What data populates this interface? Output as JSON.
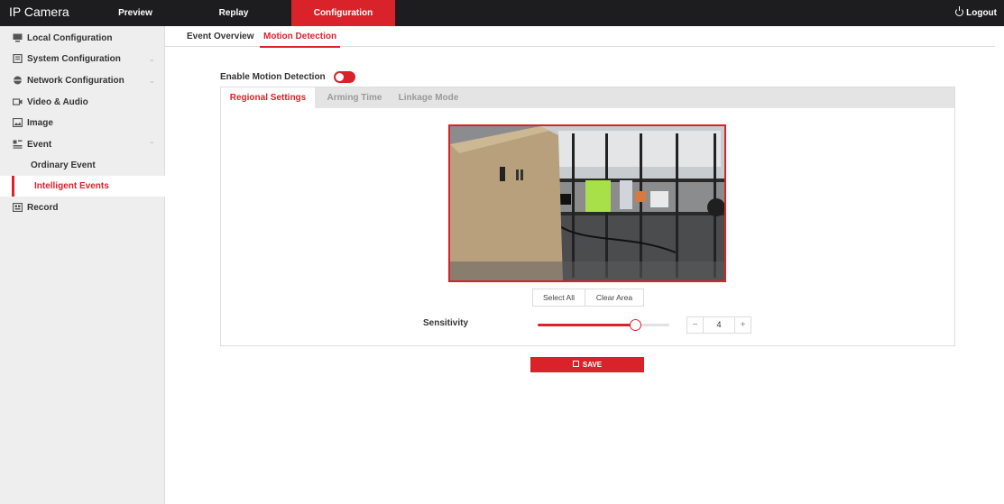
{
  "app": {
    "title": "IP Camera"
  },
  "topnav": {
    "items": [
      {
        "label": "Preview"
      },
      {
        "label": "Replay"
      },
      {
        "label": "Configuration"
      }
    ],
    "logout_label": "Logout"
  },
  "sidebar": {
    "items": [
      {
        "label": "Local Configuration",
        "icon": "monitor-icon"
      },
      {
        "label": "System Configuration",
        "icon": "system-icon",
        "chevron": "⌄"
      },
      {
        "label": "Network Configuration",
        "icon": "globe-icon",
        "chevron": "⌄"
      },
      {
        "label": "Video & Audio",
        "icon": "video-audio-icon"
      },
      {
        "label": "Image",
        "icon": "image-icon"
      },
      {
        "label": "Event",
        "icon": "event-icon",
        "chevron": "⌃"
      },
      {
        "label": "Record",
        "icon": "record-icon"
      }
    ],
    "event_children": [
      {
        "label": "Ordinary Event"
      },
      {
        "label": "Intelligent Events",
        "active": true
      }
    ]
  },
  "subtabs": [
    {
      "label": "Event Overview"
    },
    {
      "label": "Motion Detection",
      "active": true
    }
  ],
  "motion": {
    "enable_label": "Enable Motion Detection",
    "enabled": true,
    "panel_tabs": [
      {
        "label": "Regional Settings",
        "active": true
      },
      {
        "label": "Arming Time"
      },
      {
        "label": "Linkage Mode"
      }
    ],
    "select_all_label": "Select All",
    "clear_area_label": "Clear Area",
    "sensitivity_label": "Sensitivity",
    "sensitivity_value": "4",
    "sensitivity_fraction": 0.74,
    "minus_label": "−",
    "plus_label": "+",
    "save_label": "SAVE"
  },
  "colors": {
    "accent": "#d9222a",
    "topbar": "#1d1d1f",
    "sidebar": "#eeeeee"
  }
}
